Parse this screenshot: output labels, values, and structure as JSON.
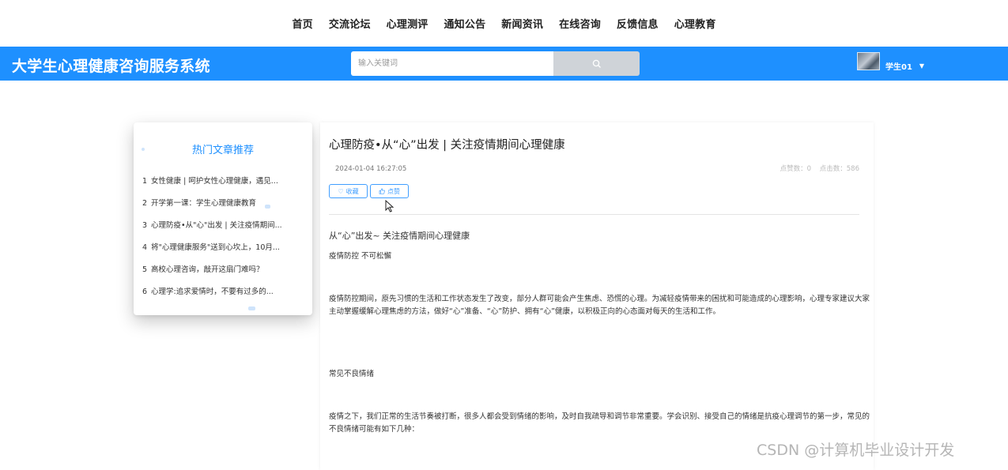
{
  "nav": {
    "items": [
      "首页",
      "交流论坛",
      "心理测评",
      "通知公告",
      "新闻资讯",
      "在线咨询",
      "反馈信息",
      "心理教育"
    ]
  },
  "header": {
    "title": "大学生心理健康咨询服务系统",
    "search_placeholder": "输入关键词",
    "search_icon": "search-icon",
    "username": "学生01",
    "caret_icon": "caret-down-icon"
  },
  "sidebar": {
    "title": "热门文章推荐",
    "items": [
      {
        "num": "1",
        "label": "女性健康 | 呵护女性心理健康，遇见..."
      },
      {
        "num": "2",
        "label": "开学第一课：学生心理健康教育"
      },
      {
        "num": "3",
        "label": "心理防疫•从\"心\"出发 | 关注疫情期间..."
      },
      {
        "num": "4",
        "label": "将\"心理健康服务\"送到心坎上，10月..."
      },
      {
        "num": "5",
        "label": "高校心理咨询，敲开这扇门难吗？"
      },
      {
        "num": "6",
        "label": "心理学:追求爱情时，不要有过多的..."
      }
    ]
  },
  "article": {
    "title": "心理防疫•从“心”出发 | 关注疫情期间心理健康",
    "date": "2024-01-04 16:27:05",
    "likes_label": "点赞数：0",
    "clicks_label": "点击数：586",
    "collect_label": "收藏",
    "like_label": "点赞",
    "subtitle": "从“心”出发~ 关注疫情期间心理健康",
    "p1": "疫情防控 不可松懈",
    "p2": "疫情防控期间，原先习惯的生活和工作状态发生了改变，部分人群可能会产生焦虑、恐慌的心理。为减轻疫情带来的困扰和可能造成的心理影响，心理专家建议大家主动掌握缓解心理焦虑的方法，做好“心”准备、“心”防护、拥有“心”健康，以积极正向的心态面对每天的生活和工作。",
    "p3": "常见不良情绪",
    "p4": "疫情之下，我们正常的生活节奏被打断，很多人都会受到情绪的影响，及时自我疏导和调节非常重要。学会识别、接受自己的情绪是抗疫心理调节的第一步，常见的不良情绪可能有如下几种："
  },
  "watermark": "CSDN @计算机毕业设计开发",
  "colors": {
    "brand": "#1e90ff",
    "search_button": "#cfd3d8",
    "button_border": "#409eff"
  }
}
